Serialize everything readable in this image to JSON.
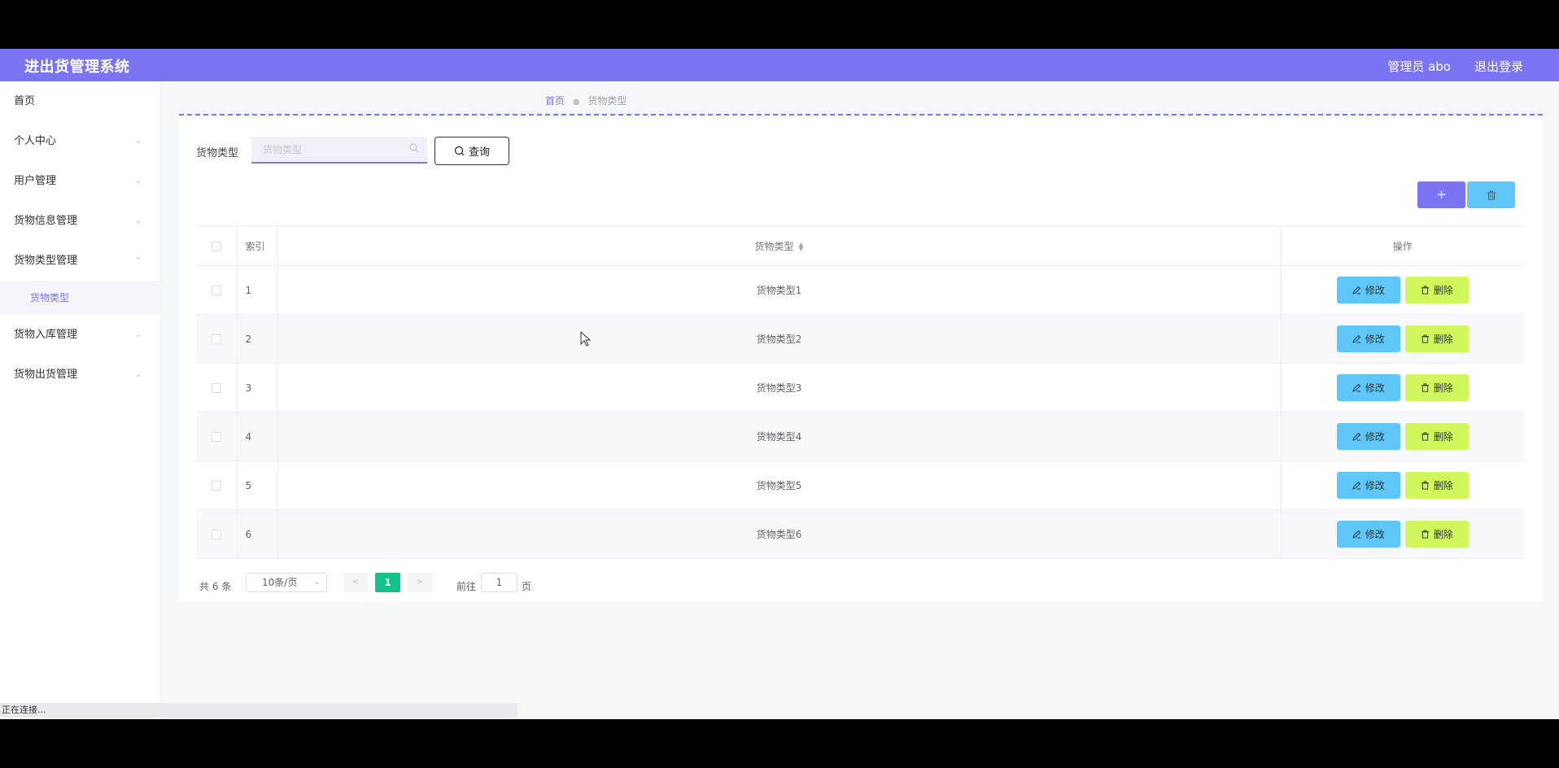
{
  "header": {
    "title": "进出货管理系统",
    "user": "管理员 abo",
    "logout": "退出登录"
  },
  "sidebar": {
    "items": [
      {
        "label": "首页"
      },
      {
        "label": "个人中心"
      },
      {
        "label": "用户管理"
      },
      {
        "label": "货物信息管理"
      },
      {
        "label": "货物类型管理",
        "expanded": true
      },
      {
        "label": "货物入库管理"
      },
      {
        "label": "货物出货管理"
      }
    ],
    "sub_item": "货物类型"
  },
  "breadcrumb": {
    "home": "首页",
    "current": "货物类型"
  },
  "search": {
    "label": "货物类型",
    "placeholder": "货物类型",
    "button": "查询"
  },
  "actions": {
    "add": "+"
  },
  "table": {
    "headers": {
      "index": "索引",
      "type": "货物类型",
      "ops": "操作"
    },
    "rows": [
      {
        "idx": "1",
        "type": "货物类型1"
      },
      {
        "idx": "2",
        "type": "货物类型2"
      },
      {
        "idx": "3",
        "type": "货物类型3"
      },
      {
        "idx": "4",
        "type": "货物类型4"
      },
      {
        "idx": "5",
        "type": "货物类型5"
      },
      {
        "idx": "6",
        "type": "货物类型6"
      }
    ],
    "edit_label": "修改",
    "delete_label": "删除"
  },
  "pagination": {
    "total": "共 6 条",
    "page_size": "10条/页",
    "current": "1",
    "goto_prefix": "前往",
    "goto_value": "1",
    "goto_suffix": "页"
  },
  "status": {
    "text": "正在连接..."
  },
  "colors": {
    "primary": "#7a74f3",
    "edit": "#5ec7f7",
    "delete": "#d0f75c",
    "page_active": "#13c28d"
  }
}
